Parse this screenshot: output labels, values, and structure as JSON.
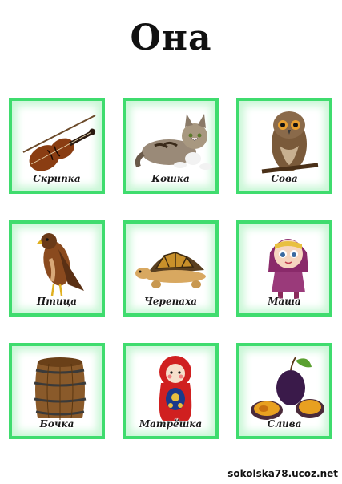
{
  "title": "Она",
  "cards": [
    {
      "label": "Скрипка",
      "icon": "violin-icon"
    },
    {
      "label": "Кошка",
      "icon": "cat-icon"
    },
    {
      "label": "Сова",
      "icon": "owl-icon"
    },
    {
      "label": "Птица",
      "icon": "hawk-icon"
    },
    {
      "label": "Черепаха",
      "icon": "turtle-icon"
    },
    {
      "label": "Маша",
      "icon": "masha-icon"
    },
    {
      "label": "Бочка",
      "icon": "barrel-icon"
    },
    {
      "label": "Матрёшка",
      "icon": "matryoshka-icon"
    },
    {
      "label": "Слива",
      "icon": "plum-icon"
    }
  ],
  "watermark": "sokolska78.ucoz.net",
  "colors": {
    "frame": "#3fdc6e",
    "frame_glow": "#c9f7d6"
  }
}
